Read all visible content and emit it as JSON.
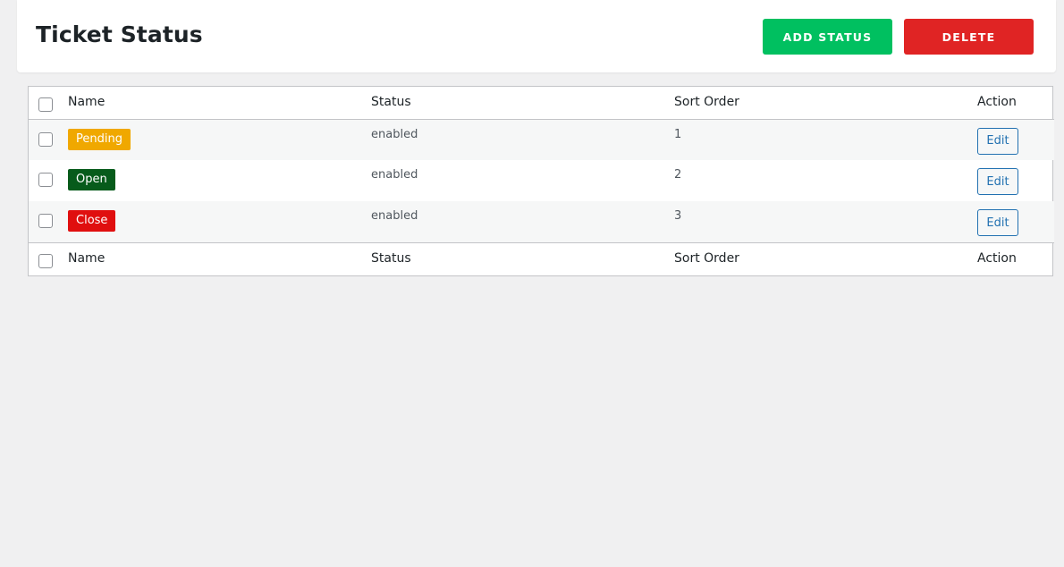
{
  "page": {
    "title": "Ticket Status",
    "add_label": "ADD STATUS",
    "delete_label": "DELETE"
  },
  "colors": {
    "add_button": "#00c060",
    "delete_button": "#e02424"
  },
  "table": {
    "headers": {
      "name": "Name",
      "status": "Status",
      "sort_order": "Sort Order",
      "action": "Action"
    },
    "rows": [
      {
        "name": "Pending",
        "badge_color": "#f0a800",
        "status": "enabled",
        "sort_order": "1",
        "action": "Edit"
      },
      {
        "name": "Open",
        "badge_color": "#075b1b",
        "status": "enabled",
        "sort_order": "2",
        "action": "Edit"
      },
      {
        "name": "Close",
        "badge_color": "#e00f0f",
        "status": "enabled",
        "sort_order": "3",
        "action": "Edit"
      }
    ]
  }
}
